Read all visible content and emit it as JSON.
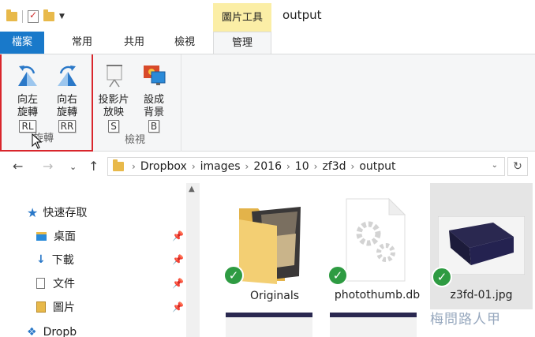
{
  "window": {
    "title": "output",
    "context_tab": "圖片工具"
  },
  "tabs": {
    "file": "檔案",
    "home": "常用",
    "share": "共用",
    "view": "檢視",
    "manage": "管理"
  },
  "ribbon": {
    "rotate_group": {
      "label": "旋轉",
      "left": {
        "line1": "向左",
        "line2": "旋轉",
        "keytip": "RL"
      },
      "right": {
        "line1": "向右",
        "line2": "旋轉",
        "keytip": "RR"
      }
    },
    "view_group": {
      "label": "檢視",
      "slideshow": {
        "line1": "投影片",
        "line2": "放映",
        "keytip": "S"
      },
      "background": {
        "line1": "設成",
        "line2": "背景",
        "keytip": "B"
      }
    }
  },
  "address": {
    "segments": [
      "Dropbox",
      "images",
      "2016",
      "10",
      "zf3d",
      "output"
    ]
  },
  "nav": {
    "quick_access": "快速存取",
    "items": [
      {
        "label": "桌面"
      },
      {
        "label": "下載"
      },
      {
        "label": "文件"
      },
      {
        "label": "圖片"
      }
    ],
    "partial": "Dropb"
  },
  "files": [
    {
      "name": "Originals",
      "type": "folder"
    },
    {
      "name": "photothumb.db",
      "type": "file"
    },
    {
      "name": "z3fd-01.jpg",
      "type": "image"
    }
  ],
  "watermark": "梅問路人甲",
  "colors": {
    "file_tab": "#1979ca",
    "context_tab": "#fbeea6",
    "highlight_box": "#d9262c",
    "sync_check": "#2e9b42"
  }
}
